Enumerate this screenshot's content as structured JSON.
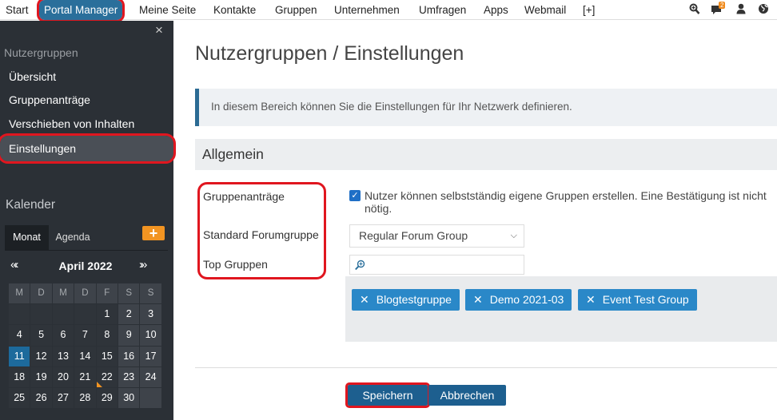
{
  "topnav": {
    "items": [
      "Start",
      "Portal Manager",
      "Meine Seite",
      "Kontakte",
      "Gruppen",
      "Unternehmen",
      "Umfragen",
      "Apps",
      "Webmail",
      "[+]"
    ],
    "notification_count": "2",
    "icons": [
      "search-plus-icon",
      "chat-icon",
      "user-icon",
      "globe-icon"
    ]
  },
  "sidebar": {
    "close": "×",
    "heading": "Nutzergruppen",
    "items": [
      "Übersicht",
      "Gruppenanträge",
      "Verschieben von Inhalten",
      "Einstellungen"
    ],
    "selected": "Einstellungen"
  },
  "calendar": {
    "title": "Kalender",
    "tabs": [
      "Monat",
      "Agenda"
    ],
    "add": "+",
    "prev": "«‹",
    "next": "›»",
    "month": "April 2022",
    "weekdays": [
      "M",
      "D",
      "M",
      "D",
      "F",
      "S",
      "S"
    ],
    "weeks": [
      [
        "",
        "",
        "",
        "",
        "1",
        "2",
        "3"
      ],
      [
        "4",
        "5",
        "6",
        "7",
        "8",
        "9",
        "10"
      ],
      [
        "11",
        "12",
        "13",
        "14",
        "15",
        "16",
        "17"
      ],
      [
        "18",
        "19",
        "20",
        "21",
        "22",
        "23",
        "24"
      ],
      [
        "25",
        "26",
        "27",
        "28",
        "29",
        "30",
        ""
      ]
    ],
    "today": "11",
    "marked_day": "22"
  },
  "main": {
    "title": "Nutzergruppen / Einstellungen",
    "info": "In diesem Bereich können Sie die Einstellungen für Ihr Netzwerk definieren.",
    "section": "Allgemein",
    "labels": {
      "requests": "Gruppenanträge",
      "forum": "Standard Forumgruppe",
      "top": "Top Gruppen"
    },
    "checkbox_checked": true,
    "checkbox_text": "Nutzer können selbstständig eigene Gruppen erstellen. Eine Bestätigung ist nicht nötig.",
    "forum_value": "Regular Forum Group",
    "search_placeholder": "",
    "tags": [
      "Blogtestgruppe",
      "Demo 2021-03",
      "Event Test Group"
    ],
    "save": "Speichern",
    "cancel": "Abbrechen"
  },
  "colors": {
    "accent": "#2a6f9b",
    "tag": "#2a88c8",
    "highlight": "#e0161f",
    "sidebar": "#2b3036"
  }
}
